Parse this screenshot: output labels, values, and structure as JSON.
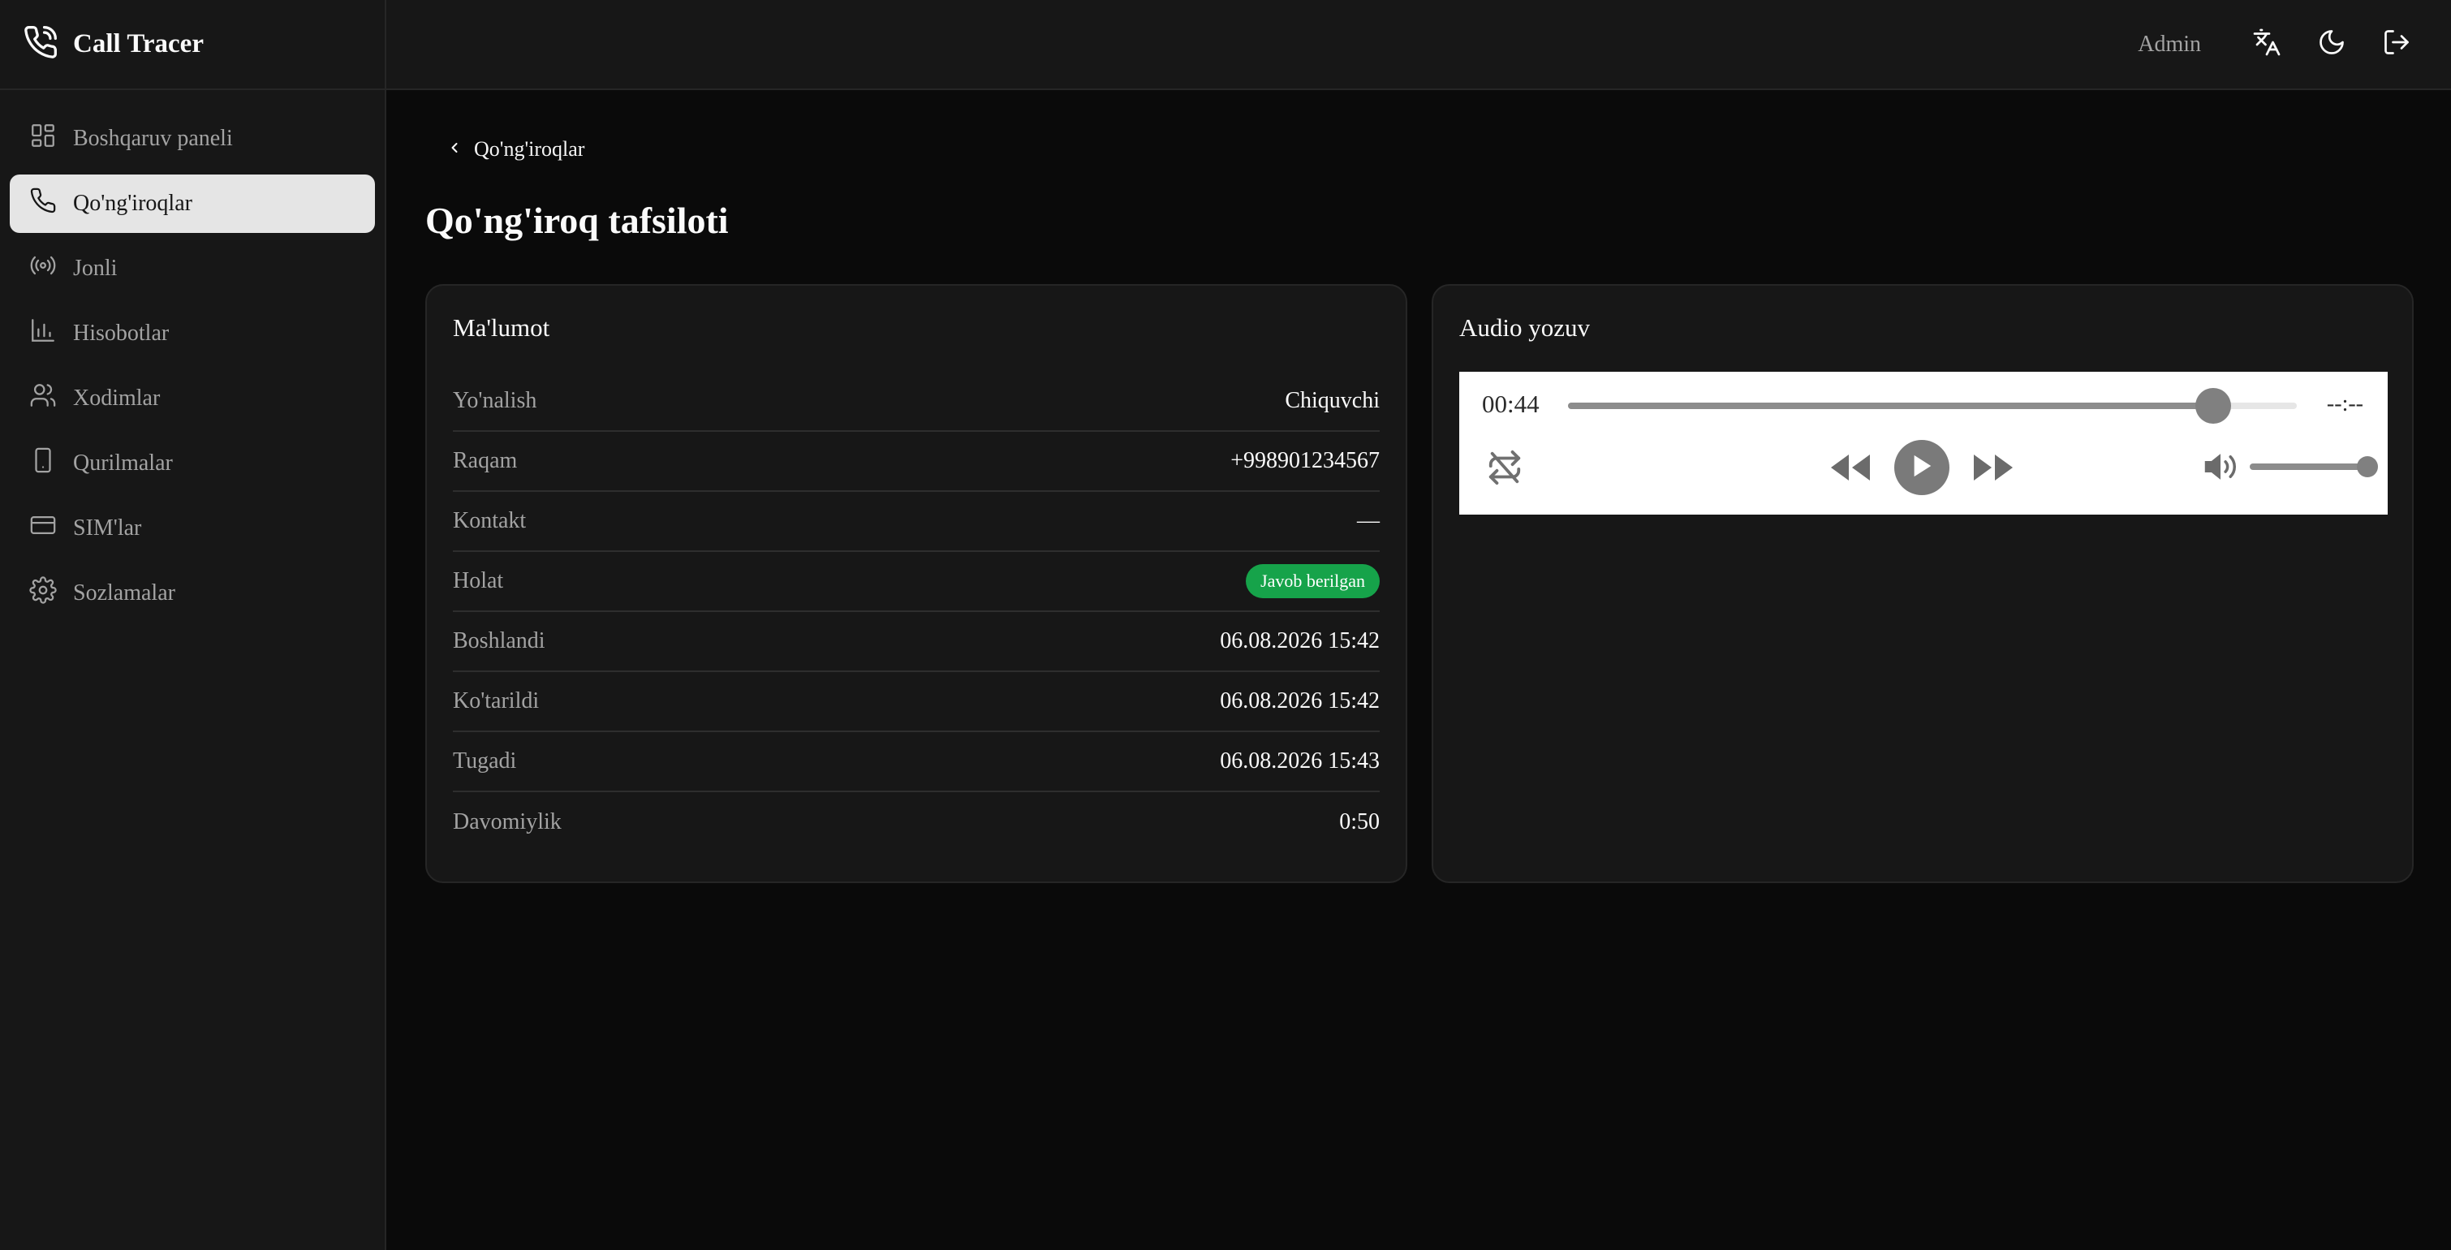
{
  "app": {
    "name": "Call Tracer"
  },
  "sidebar": {
    "items": [
      {
        "label": "Boshqaruv paneli",
        "icon": "dashboard-icon",
        "active": false
      },
      {
        "label": "Qo'ng'iroqlar",
        "icon": "phone-icon",
        "active": true
      },
      {
        "label": "Jonli",
        "icon": "radio-icon",
        "active": false
      },
      {
        "label": "Hisobotlar",
        "icon": "chart-icon",
        "active": false
      },
      {
        "label": "Xodimlar",
        "icon": "users-icon",
        "active": false
      },
      {
        "label": "Qurilmalar",
        "icon": "smartphone-icon",
        "active": false
      },
      {
        "label": "SIM'lar",
        "icon": "card-icon",
        "active": false
      },
      {
        "label": "Sozlamalar",
        "icon": "gear-icon",
        "active": false
      }
    ]
  },
  "topbar": {
    "user": "Admin",
    "icons": [
      "translate-icon",
      "moon-icon",
      "logout-icon"
    ]
  },
  "page": {
    "back_label": "Qo'ng'iroqlar",
    "title": "Qo'ng'iroq tafsiloti"
  },
  "info_card": {
    "title": "Ma'lumot",
    "rows": [
      {
        "label": "Yo'nalish",
        "value": "Chiquvchi"
      },
      {
        "label": "Raqam",
        "value": "+998901234567"
      },
      {
        "label": "Kontakt",
        "value": "—"
      },
      {
        "label": "Holat",
        "value": "Javob berilgan",
        "badge": true
      },
      {
        "label": "Boshlandi",
        "value": "06.08.2026 15:42"
      },
      {
        "label": "Ko'tarildi",
        "value": "06.08.2026 15:42"
      },
      {
        "label": "Tugadi",
        "value": "06.08.2026 15:43"
      },
      {
        "label": "Davomiylik",
        "value": "0:50"
      }
    ]
  },
  "audio_card": {
    "title": "Audio yozuv",
    "player": {
      "current_time": "00:44",
      "duration": "--:--",
      "progress_fraction": 0.885,
      "volume_fraction": 1.0
    }
  },
  "colors": {
    "background": "#0a0a0a",
    "sidebar": "#171717",
    "active_item": "#e5e5e5",
    "badge_green": "#16a34a"
  }
}
